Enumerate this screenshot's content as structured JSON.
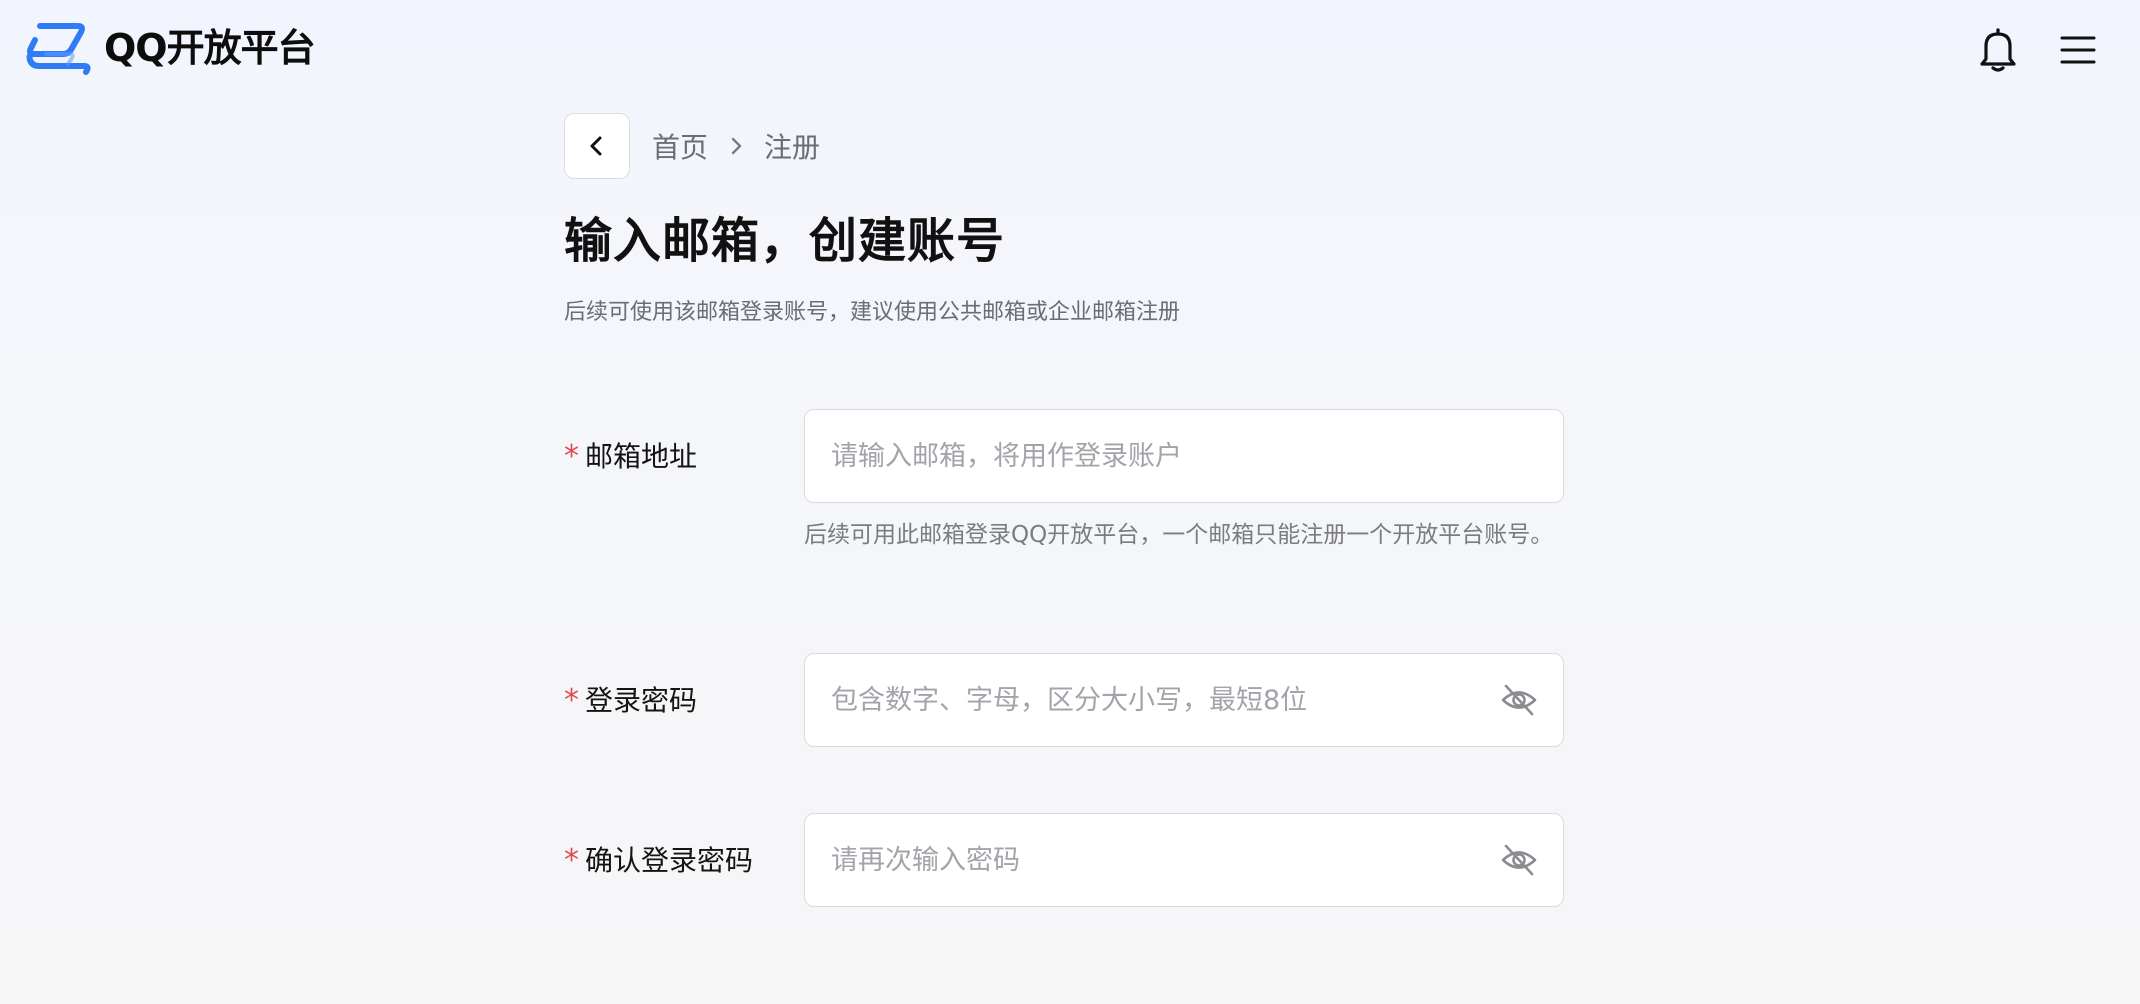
{
  "header": {
    "brand": "QQ开放平台",
    "icons": {
      "logo": "qq-open-platform-logo",
      "notifications": "bell-icon",
      "menu": "hamburger-menu-icon"
    },
    "brand_color": "#2f7cf6"
  },
  "breadcrumb": {
    "back_icon": "chevron-left-icon",
    "items": [
      "首页",
      "注册"
    ],
    "separator_icon": "chevron-right-icon"
  },
  "page": {
    "title": "输入邮箱，创建账号",
    "subtitle": "后续可使用该邮箱登录账号，建议使用公共邮箱或企业邮箱注册"
  },
  "form": {
    "required_mark": "*",
    "required_color": "#e24b4b",
    "email": {
      "label": "邮箱地址",
      "value": "",
      "placeholder": "请输入邮箱，将用作登录账户",
      "hint": "后续可用此邮箱登录QQ开放平台，一个邮箱只能注册一个开放平台账号。"
    },
    "password": {
      "label": "登录密码",
      "value": "",
      "placeholder": "包含数字、字母，区分大小写，最短8位",
      "toggle_icon": "eye-off-icon"
    },
    "confirm_password": {
      "label": "确认登录密码",
      "value": "",
      "placeholder": "请再次输入密码",
      "toggle_icon": "eye-off-icon"
    }
  }
}
